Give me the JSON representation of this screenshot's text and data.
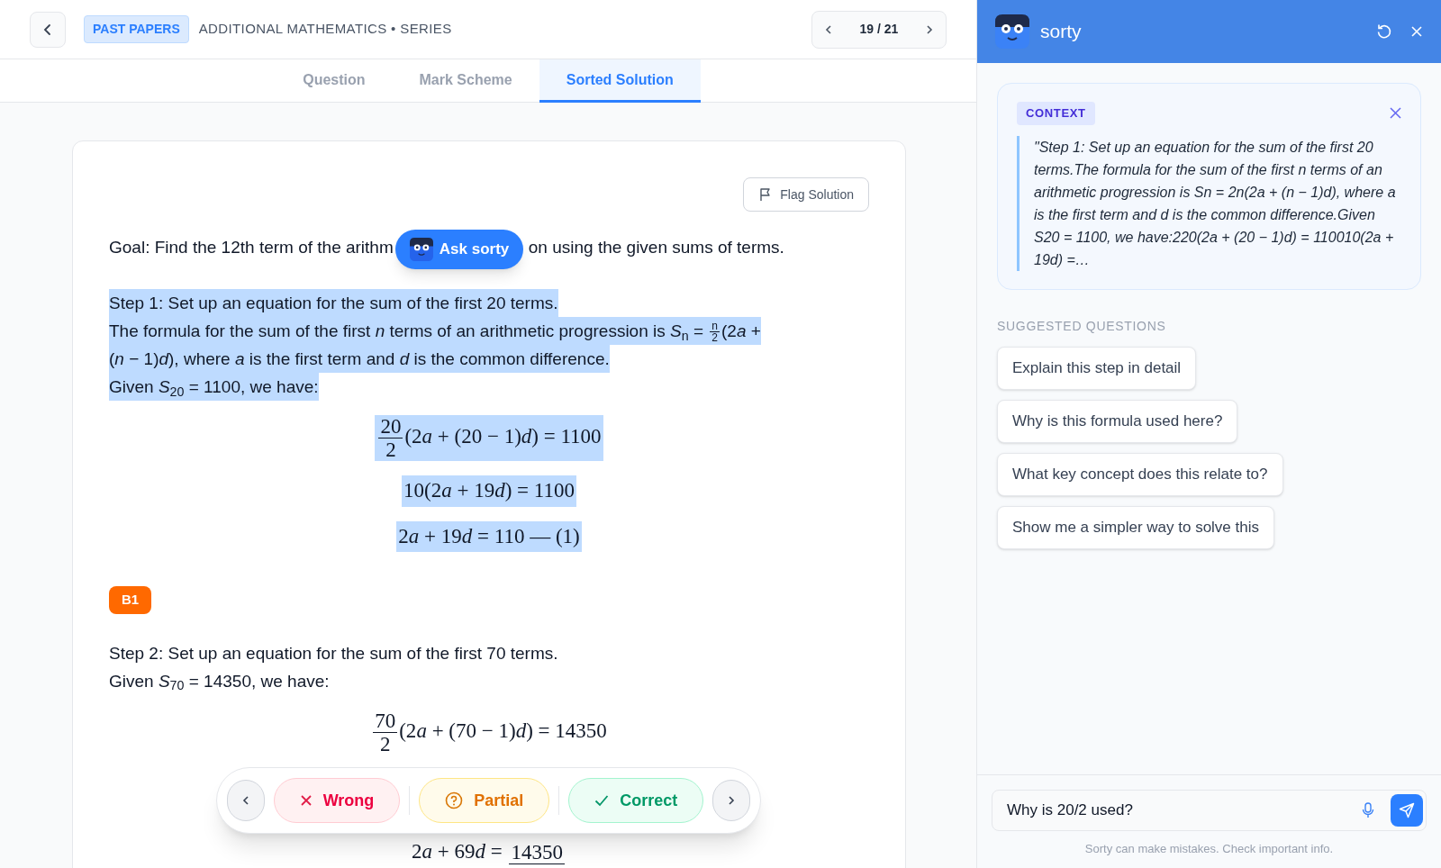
{
  "header": {
    "badge": "PAST PAPERS",
    "breadcrumb": "ADDITIONAL MATHEMATICS • SERIES",
    "pager": "19 / 21"
  },
  "tabs": [
    {
      "label": "Question",
      "selected": false
    },
    {
      "label": "Mark Scheme",
      "selected": false
    },
    {
      "label": "Sorted Solution",
      "selected": true
    }
  ],
  "flag_button": "Flag Solution",
  "goal": [
    "Goal: Find the 12th term of the arithm",
    "on using the given sums of terms."
  ],
  "ask_button": "Ask sorty",
  "blocks": [
    {
      "kind": "paragraph",
      "selected": true,
      "lines": [
        [
          "Step 1: Set up an equation for the sum of the first 20 terms."
        ],
        [
          "The formula for the sum of the first *n* terms of an arithmetic progression is *S*$_{n}$ = ",
          {
            "num": "n",
            "den": "2"
          },
          "(2",
          "*a* +"
        ],
        [
          "(*n* − 1)*d*), where *a* is the first term and *d* is the common difference."
        ],
        [
          "Given *S*$_{20}$ = 1100, we have:"
        ]
      ]
    },
    {
      "kind": "equation",
      "selected": true,
      "parts": [
        {
          "num": "20",
          "den": "2"
        },
        "(2",
        "*a* + (20 − 1)*d*) = 1100"
      ]
    },
    {
      "kind": "equation",
      "selected": true,
      "parts": [
        "10(2",
        "*a* + 19",
        "*d*) = 1100"
      ]
    },
    {
      "kind": "equation",
      "selected": true,
      "parts": [
        "2",
        "*a* + 19",
        "*d* = 110  — (1)"
      ]
    },
    {
      "kind": "mark",
      "label": "B1"
    },
    {
      "kind": "paragraph",
      "selected": false,
      "lines": [
        [
          "Step 2: Set up an equation for the sum of the first 70 terms."
        ],
        [
          "Given *S*$_{70}$ = 14350, we have:"
        ]
      ]
    },
    {
      "kind": "equation",
      "selected": false,
      "parts": [
        {
          "num": "70",
          "den": "2"
        },
        "(2",
        "*a* + (70 − 1)*d*) = 14350"
      ]
    },
    {
      "kind": "equation",
      "selected": false,
      "parts": [
        "2",
        "*a* + 69",
        "*d* = ",
        {
          "num": "14350"
        }
      ]
    }
  ],
  "ratings": [
    {
      "kind": "wrong",
      "label": "Wrong"
    },
    {
      "kind": "partial",
      "label": "Partial"
    },
    {
      "kind": "correct",
      "label": "Correct"
    }
  ],
  "assistant": {
    "title": "sorty",
    "context_label": "CONTEXT",
    "context_text": "\"Step 1: Set up an equation for the sum of the first 20 terms.The formula for the sum of the first n terms of an arithmetic progression is Sn = 2n(2a + (n − 1)d), where a is the first term and d is the common difference.Given S20 = 1100, we have:220(2a + (20 − 1)d) = 110010(2a + 19d) =…",
    "suggested_title": "SUGGESTED QUESTIONS",
    "questions": [
      "Explain this step in detail",
      "Why is this formula used here?",
      "What key concept does this relate to?",
      "Show me a simpler way to solve this"
    ],
    "input_value": "Why is 20/2 used?",
    "disclaimer": "Sorty can make mistakes. Check important info."
  }
}
